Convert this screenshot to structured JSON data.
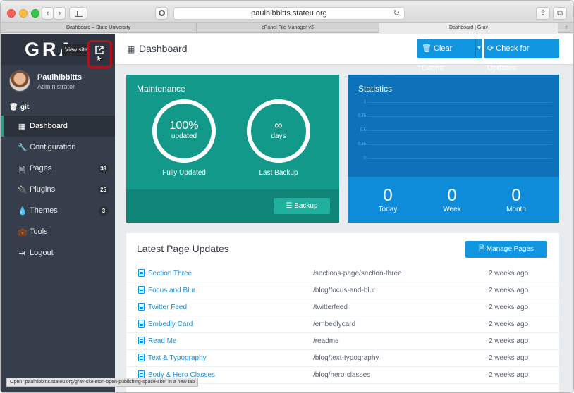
{
  "browser": {
    "url": "paulhibbitts.stateu.org",
    "tabs": [
      {
        "label": "Dashboard – State University"
      },
      {
        "label": "cPanel File Manager v3"
      },
      {
        "label": "Dashboard | Grav"
      }
    ],
    "status_text": "Open \"paulhibbitts.stateu.org/grav-skeleton-open-publishing-space-site\" in a new tab"
  },
  "sidebar": {
    "logo": "GRA",
    "view_site_tooltip": "View site",
    "user": {
      "name": "Paulhibbitts",
      "role": "Administrator"
    },
    "repo": "git",
    "items": [
      {
        "label": "Dashboard",
        "icon": "grid-icon",
        "active": true
      },
      {
        "label": "Configuration",
        "icon": "wrench-icon"
      },
      {
        "label": "Pages",
        "icon": "file-icon",
        "badge": "38"
      },
      {
        "label": "Plugins",
        "icon": "plug-icon",
        "badge": "25"
      },
      {
        "label": "Themes",
        "icon": "tint-icon",
        "badge": "3"
      },
      {
        "label": "Tools",
        "icon": "briefcase-icon"
      },
      {
        "label": "Logout",
        "icon": "sign-out-icon"
      }
    ]
  },
  "header": {
    "title": "Dashboard",
    "clear_cache": "Clear Cache",
    "check_updates": "Check for Updates"
  },
  "maintenance": {
    "title": "Maintenance",
    "updated_value": "100%",
    "updated_unit": "updated",
    "updated_label": "Fully Updated",
    "backup_value": "∞",
    "backup_unit": "days",
    "backup_label": "Last Backup",
    "backup_button": "Backup"
  },
  "statistics": {
    "title": "Statistics",
    "y_ticks": [
      "1",
      "0.75",
      "0.5",
      "0.25",
      "0"
    ],
    "today": {
      "value": "0",
      "label": "Today"
    },
    "week": {
      "value": "0",
      "label": "Week"
    },
    "month": {
      "value": "0",
      "label": "Month"
    }
  },
  "updates": {
    "title": "Latest Page Updates",
    "manage_button": "Manage Pages",
    "rows": [
      {
        "title": "Section Three",
        "route": "/sections-page/section-three",
        "ago": "2 weeks ago"
      },
      {
        "title": "Focus and Blur",
        "route": "/blog/focus-and-blur",
        "ago": "2 weeks ago"
      },
      {
        "title": "Twitter Feed",
        "route": "/twitterfeed",
        "ago": "2 weeks ago"
      },
      {
        "title": "Embedly Card",
        "route": "/embedlycard",
        "ago": "2 weeks ago"
      },
      {
        "title": "Read Me",
        "route": "/readme",
        "ago": "2 weeks ago"
      },
      {
        "title": "Text & Typography",
        "route": "/blog/text-typography",
        "ago": "2 weeks ago"
      },
      {
        "title": "Body & Hero Classes",
        "route": "/blog/hero-classes",
        "ago": "2 weeks ago"
      }
    ]
  },
  "colors": {
    "sidebar": "#373e4b",
    "maintenance": "#13998a",
    "statistics": "#0e7fca",
    "accent_blue": "#1197e1",
    "highlight_annotation": "#b3121b"
  }
}
